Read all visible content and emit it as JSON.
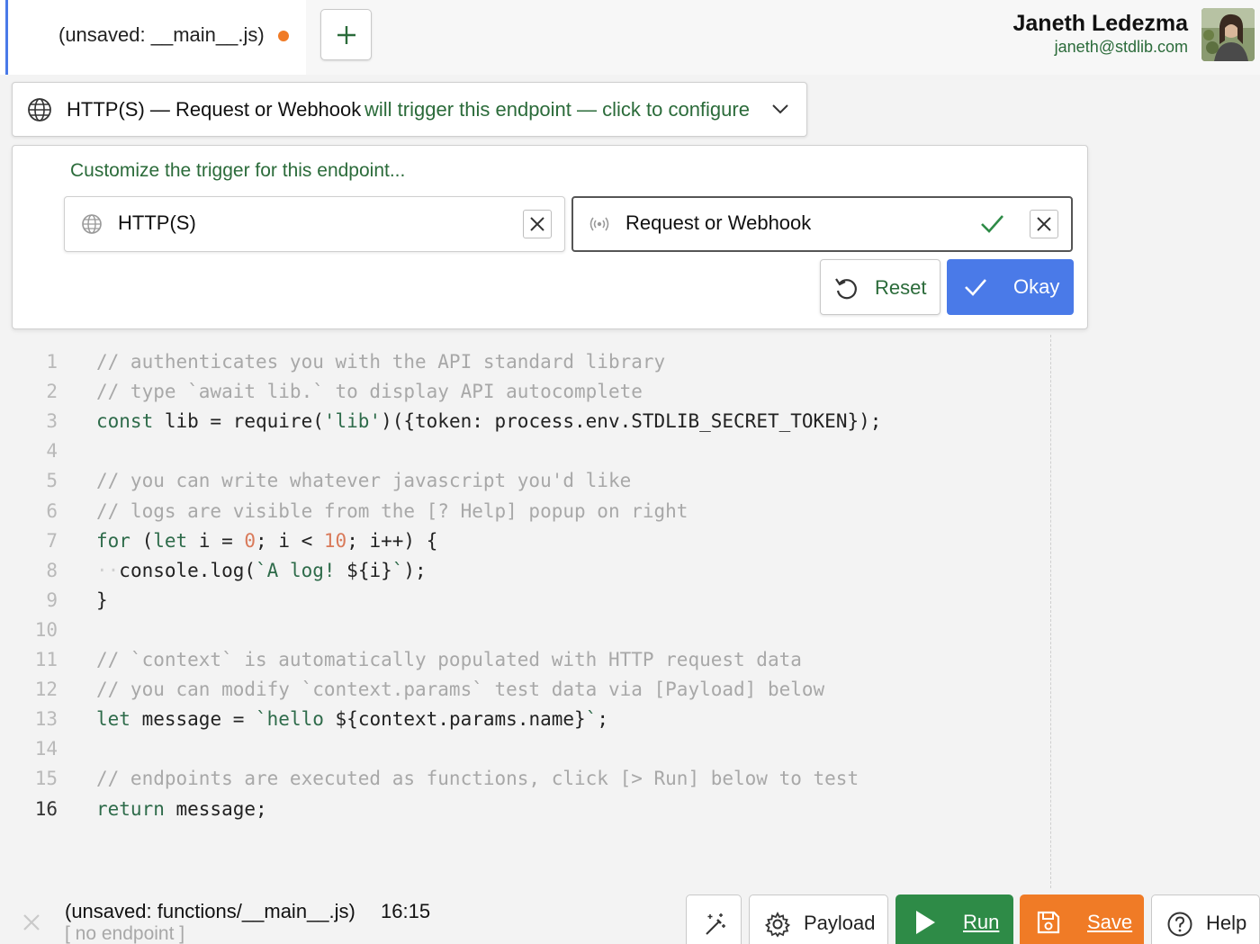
{
  "tab": {
    "label": "(unsaved: __main__.js)",
    "unsaved_color": "#f07b26"
  },
  "user": {
    "name": "Janeth Ledezma",
    "email": "janeth@stdlib.com"
  },
  "trigger": {
    "title": "HTTP(S) — Request or Webhook",
    "subtitle": "will trigger this endpoint — click to configure"
  },
  "config": {
    "heading": "Customize the trigger for this endpoint...",
    "fields": [
      {
        "label": "HTTP(S)",
        "icon": "globe-icon"
      },
      {
        "label": "Request or Webhook",
        "icon": "broadcast-icon"
      }
    ],
    "reset_label": "Reset",
    "okay_label": "Okay"
  },
  "editor": {
    "active_line": 16,
    "lines": [
      {
        "n": "1",
        "tokens": [
          [
            "com",
            "// authenticates you with the API standard library"
          ]
        ]
      },
      {
        "n": "2",
        "tokens": [
          [
            "com",
            "// type `await lib.` to display API autocomplete"
          ]
        ]
      },
      {
        "n": "3",
        "tokens": [
          [
            "kw",
            "const"
          ],
          [
            "id",
            " lib = require("
          ],
          [
            "str",
            "'lib'"
          ],
          [
            "id",
            ")({token: process.env.STDLIB_SECRET_TOKEN});"
          ]
        ]
      },
      {
        "n": "4",
        "tokens": []
      },
      {
        "n": "5",
        "tokens": [
          [
            "com",
            "// you can write whatever javascript you'd like"
          ]
        ]
      },
      {
        "n": "6",
        "tokens": [
          [
            "com",
            "// logs are visible from the [? Help] popup on right"
          ]
        ]
      },
      {
        "n": "7",
        "tokens": [
          [
            "kw",
            "for"
          ],
          [
            "id",
            " ("
          ],
          [
            "kw",
            "let"
          ],
          [
            "id",
            " i = "
          ],
          [
            "num",
            "0"
          ],
          [
            "id",
            "; i < "
          ],
          [
            "num",
            "10"
          ],
          [
            "id",
            "; i++) {"
          ]
        ]
      },
      {
        "n": "8",
        "tokens": [
          [
            "ws",
            "··"
          ],
          [
            "id",
            "console.log("
          ],
          [
            "str",
            "`A log! "
          ],
          [
            "id",
            "${i}"
          ],
          [
            "str",
            "`"
          ],
          [
            "id",
            ");"
          ]
        ]
      },
      {
        "n": "9",
        "tokens": [
          [
            "id",
            "}"
          ]
        ]
      },
      {
        "n": "10",
        "tokens": []
      },
      {
        "n": "11",
        "tokens": [
          [
            "com",
            "// `context` is automatically populated with HTTP request data"
          ]
        ]
      },
      {
        "n": "12",
        "tokens": [
          [
            "com",
            "// you can modify `context.params` test data via [Payload] below"
          ]
        ]
      },
      {
        "n": "13",
        "tokens": [
          [
            "kw",
            "let"
          ],
          [
            "id",
            " message = "
          ],
          [
            "str",
            "`hello "
          ],
          [
            "id",
            "${context.params.name}"
          ],
          [
            "str",
            "`"
          ],
          [
            "id",
            ";"
          ]
        ]
      },
      {
        "n": "14",
        "tokens": []
      },
      {
        "n": "15",
        "tokens": [
          [
            "com",
            "// endpoints are executed as functions, click [> Run] below to test"
          ]
        ]
      },
      {
        "n": "16",
        "tokens": [
          [
            "kw",
            "return"
          ],
          [
            "id",
            " message;"
          ]
        ]
      }
    ]
  },
  "status": {
    "file_path": "(unsaved: functions/__main__.js)",
    "cursor": "16:15",
    "endpoint": "[ no endpoint ]"
  },
  "toolbar": {
    "payload_label": "Payload",
    "run_label": "Run",
    "save_label": "Save",
    "help_label": "Help"
  },
  "colors": {
    "accent_blue": "#4a7ae8",
    "run_green": "#2e8b47",
    "save_orange": "#f07b26",
    "text_green": "#2b6b3a"
  }
}
